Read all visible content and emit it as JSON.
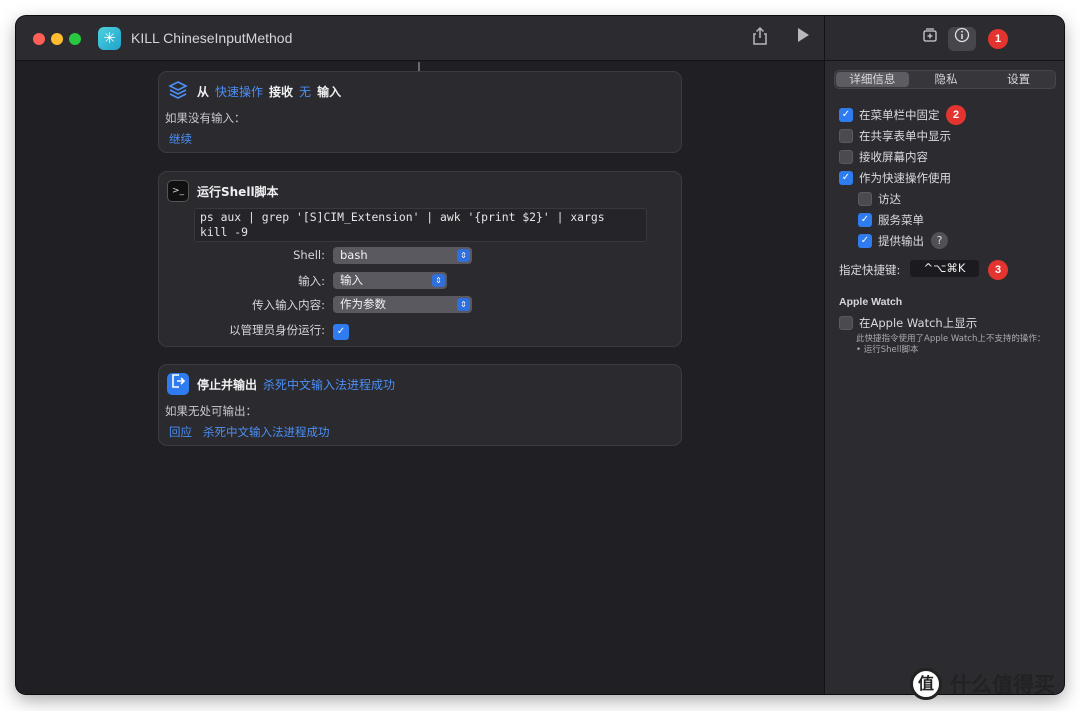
{
  "window": {
    "title": "KILL ChineseInputMethod",
    "app_icon": "shortcuts-icon",
    "share_icon": "share-icon",
    "run_icon": "play-icon"
  },
  "actions": {
    "receive": {
      "from": "从",
      "quick_action": "快速操作",
      "receive": "接收",
      "none": "无",
      "input": "输入",
      "if_no_input": "如果没有输入：",
      "continue": "继续"
    },
    "shell": {
      "title": "运行Shell脚本",
      "script": "ps aux | grep '[S]CIM_Extension' | awk '{print $2}' | xargs\nkill -9",
      "shell_label": "Shell:",
      "shell_value": "bash",
      "input_label": "输入:",
      "input_value": "输入",
      "pass_label": "传入输入内容:",
      "pass_value": "作为参数",
      "admin_label": "以管理员身份运行:",
      "admin_checked": true
    },
    "stop": {
      "title": "停止并输出",
      "output": "杀死中文输入法进程成功",
      "if_nowhere": "如果无处可输出：",
      "reply": "回应",
      "reply_value": "杀死中文输入法进程成功"
    }
  },
  "inspector": {
    "add_icon": "add-library-icon",
    "info_icon": "info-icon",
    "tabs": [
      "详细信息",
      "隐私",
      "设置"
    ],
    "selected_tab": "详细信息",
    "options": {
      "pin_menu": "在菜单栏中固定",
      "share_sheet": "在共享表单中显示",
      "screen": "接收屏幕内容",
      "quick_action": "作为快速操作使用",
      "finder": "访达",
      "services": "服务菜单",
      "provide_output": "提供输出"
    },
    "help": "?",
    "shortcut_label": "指定快捷键:",
    "shortcut_value": "^⌥⌘K",
    "watch_section": "Apple Watch",
    "watch_show": "在Apple Watch上显示",
    "watch_note_1": "此快捷指令使用了Apple Watch上不支持的操作：",
    "watch_note_2": "• 运行Shell脚本"
  },
  "annotations": [
    "1",
    "2",
    "3"
  ],
  "watermark": {
    "logo": "值",
    "text": "什么值得买"
  }
}
